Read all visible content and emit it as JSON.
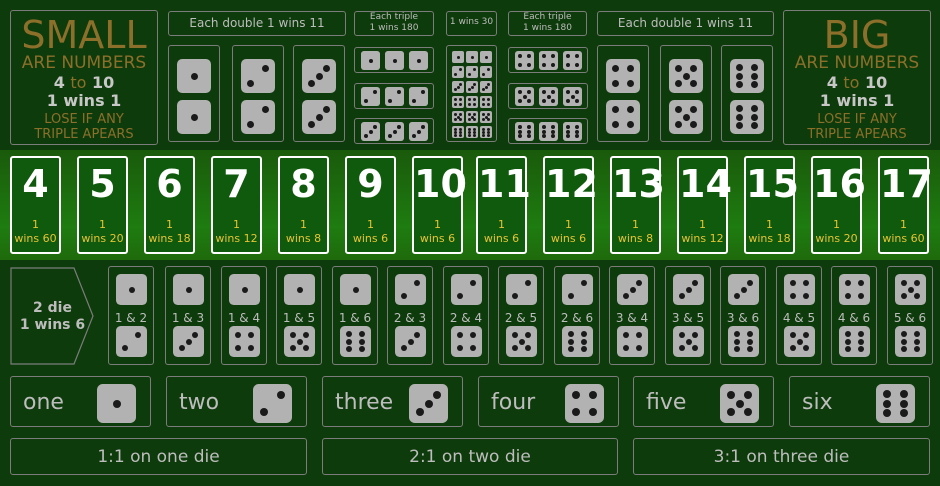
{
  "small": {
    "title": "SMALL",
    "subtitle": "ARE NUMBERS",
    "range": "4 to 10",
    "payout": "1 wins 1",
    "note1": "LOSE IF ANY",
    "note2": "TRIPLE APEARS"
  },
  "big": {
    "title": "BIG",
    "subtitle": "ARE NUMBERS",
    "range": "4 to 10",
    "payout": "1 wins 1",
    "note1": "LOSE IF ANY",
    "note2": "TRIPLE APEARS"
  },
  "doubles_left_label": "Each double 1 wins 11",
  "doubles_right_label": "Each double 1 wins 11",
  "triples_left_label1": "Each triple",
  "triples_left_label2": "1 wins 180",
  "triples_right_label1": "Each triple",
  "triples_right_label2": "1 wins 180",
  "any_triple_label": "1 wins 30",
  "totals": [
    {
      "n": "4",
      "o": "1",
      "w": "wins 60"
    },
    {
      "n": "5",
      "o": "1",
      "w": "wins 20"
    },
    {
      "n": "6",
      "o": "1",
      "w": "wins 18"
    },
    {
      "n": "7",
      "o": "1",
      "w": "wins 12"
    },
    {
      "n": "8",
      "o": "1",
      "w": "wins 8"
    },
    {
      "n": "9",
      "o": "1",
      "w": "wins 6"
    },
    {
      "n": "10",
      "o": "1",
      "w": "wins 6"
    },
    {
      "n": "11",
      "o": "1",
      "w": "wins 6"
    },
    {
      "n": "12",
      "o": "1",
      "w": "wins 6"
    },
    {
      "n": "13",
      "o": "1",
      "w": "wins 8"
    },
    {
      "n": "14",
      "o": "1",
      "w": "wins 12"
    },
    {
      "n": "15",
      "o": "1",
      "w": "wins 18"
    },
    {
      "n": "16",
      "o": "1",
      "w": "wins 20"
    },
    {
      "n": "17",
      "o": "1",
      "w": "wins 60"
    }
  ],
  "two_die_label1": "2 die",
  "two_die_label2": "1 wins 6",
  "pairs": [
    "1 & 2",
    "1 & 3",
    "1 & 4",
    "1 & 5",
    "1 & 6",
    "2 & 3",
    "2 & 4",
    "2 & 5",
    "2 & 6",
    "3 & 4",
    "3 & 5",
    "3 & 6",
    "4 & 5",
    "4 & 6",
    "5 & 6"
  ],
  "singles": [
    "one",
    "two",
    "three",
    "four",
    "five",
    "six"
  ],
  "bottom": [
    "1:1 on one die",
    "2:1 on two die",
    "3:1 on three die"
  ],
  "colors": {
    "felt": "#0e3b0b",
    "band": "#1e7c10",
    "gold": "#8b6f2b",
    "payout": "#e8c433",
    "die": "#b2b2b2"
  }
}
